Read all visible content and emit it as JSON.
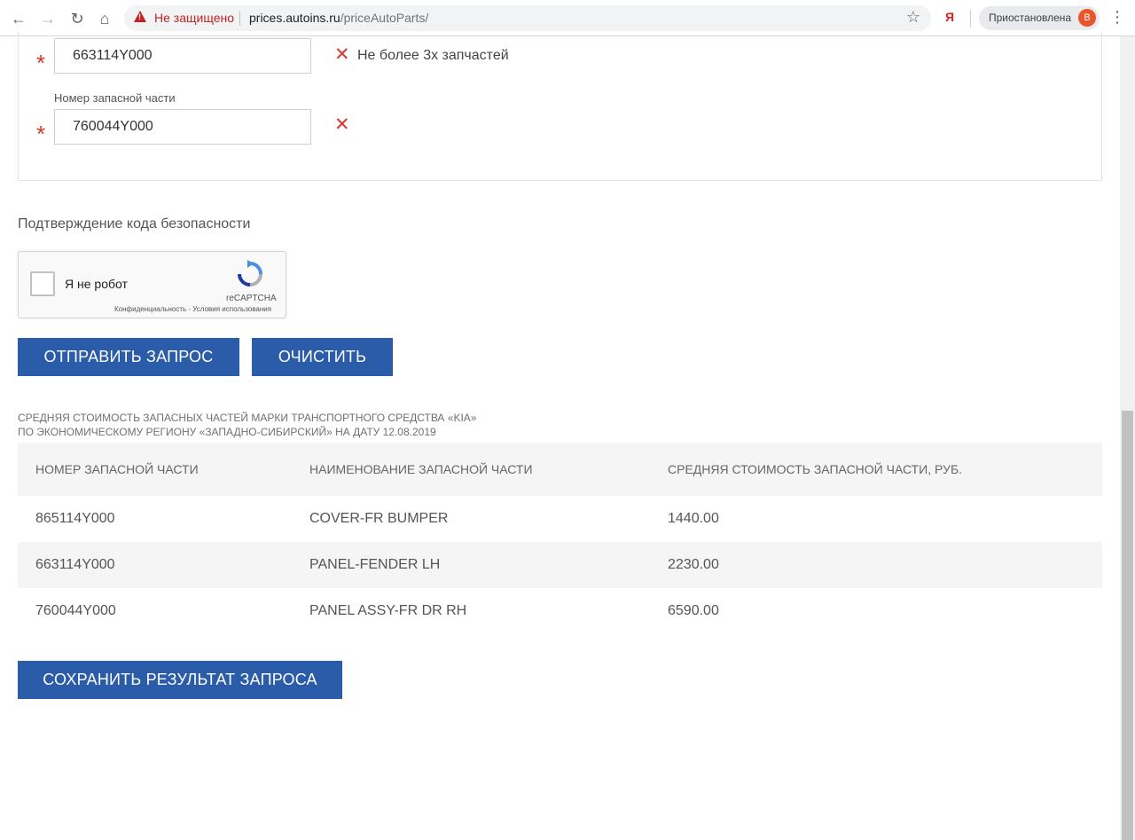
{
  "browser": {
    "security_label": "Не защищено",
    "url_host": "prices.autoins.ru",
    "url_path": "/priceAutoParts/",
    "ya_label": "Я",
    "profile_status": "Приостановлена",
    "avatar_letter": "B"
  },
  "form": {
    "parts": [
      {
        "label": "",
        "value": "663114Y000",
        "error": "Не более 3х запчастей"
      },
      {
        "label": "Номер запасной части",
        "value": "760044Y000",
        "error": ""
      }
    ]
  },
  "security": {
    "title": "Подтверждение кода безопасности",
    "captcha_label": "Я не робот",
    "captcha_brand": "reCAPTCHA",
    "captcha_terms": "Конфиденциальность - Условия использования"
  },
  "buttons": {
    "submit": "ОТПРАВИТЬ ЗАПРОС",
    "clear": "ОЧИСТИТЬ",
    "save": "СОХРАНИТЬ РЕЗУЛЬТАТ ЗАПРОСА"
  },
  "results": {
    "caption_line1": "Средняя стоимость запасных частей марки транспортного средства «KIA»",
    "caption_line2": "по экономическому региону «Западно-Сибирский» на дату 12.08.2019",
    "headers": [
      "НОМЕР ЗАПАСНОЙ ЧАСТИ",
      "НАИМЕНОВАНИЕ ЗАПАСНОЙ ЧАСТИ",
      "СРЕДНЯЯ СТОИМОСТЬ ЗАПАСНОЙ ЧАСТИ, РУБ."
    ],
    "rows": [
      [
        "865114Y000",
        "COVER-FR BUMPER",
        "1440.00"
      ],
      [
        "663114Y000",
        "PANEL-FENDER LH",
        "2230.00"
      ],
      [
        "760044Y000",
        "PANEL ASSY-FR DR RH",
        "6590.00"
      ]
    ]
  },
  "colors": {
    "primary_button": "#2b5ca9",
    "required_mark": "#d9382f",
    "insecure_warning": "#c5221f"
  },
  "icons": [
    "back-arrow-icon",
    "forward-arrow-icon",
    "reload-icon",
    "home-icon",
    "warning-triangle-icon",
    "star-icon",
    "menu-dots-icon",
    "remove-x-icon",
    "recaptcha-logo-icon"
  ]
}
